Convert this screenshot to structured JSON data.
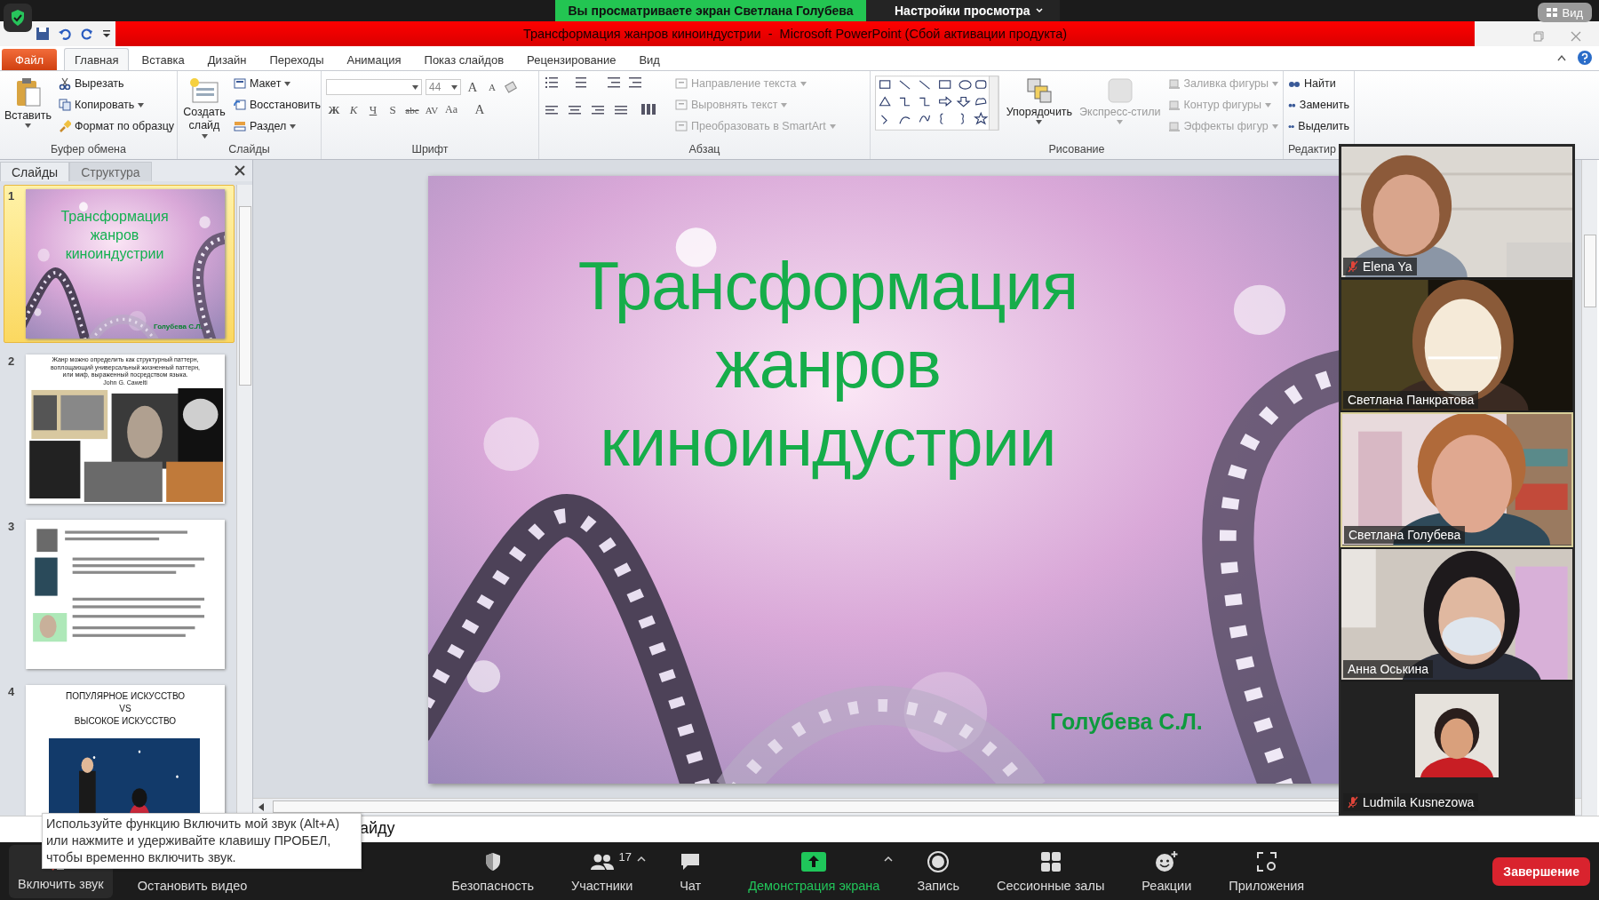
{
  "zoom_top": {
    "banner": "Вы просматриваете экран Светлана Голубева",
    "settings": "Настройки просмотра",
    "view": "Вид"
  },
  "window": {
    "title": "Трансформация жанров киноиндустрии  -  Microsoft PowerPoint (Сбой активации продукта)"
  },
  "tabs": [
    {
      "label": "Файл",
      "kind": "file",
      "selected": false
    },
    {
      "label": "Главная",
      "kind": "tab",
      "selected": true
    },
    {
      "label": "Вставка",
      "kind": "tab",
      "selected": false
    },
    {
      "label": "Дизайн",
      "kind": "tab",
      "selected": false
    },
    {
      "label": "Переходы",
      "kind": "tab",
      "selected": false
    },
    {
      "label": "Анимация",
      "kind": "tab",
      "selected": false
    },
    {
      "label": "Показ слайдов",
      "kind": "tab",
      "selected": false
    },
    {
      "label": "Рецензирование",
      "kind": "tab",
      "selected": false
    },
    {
      "label": "Вид",
      "kind": "tab",
      "selected": false
    }
  ],
  "ribbon": {
    "clipboard": {
      "label": "Буфер обмена",
      "paste": "Вставить",
      "cut": "Вырезать",
      "copy": "Копировать",
      "format_painter": "Формат по образцу"
    },
    "slides": {
      "label": "Слайды",
      "new_slide": "Создать слайд",
      "layout": "Макет",
      "reset": "Восстановить",
      "section": "Раздел"
    },
    "font": {
      "label": "Шрифт",
      "font_size": "44",
      "size_buttons": [
        "A",
        "A"
      ],
      "buttons": [
        "Ж",
        "К",
        "Ч",
        "S",
        "abc",
        "AV",
        "Aa",
        "A"
      ]
    },
    "paragraph": {
      "label": "Абзац",
      "items": [
        {
          "label": "Направление текста",
          "disabled": true
        },
        {
          "label": "Выровнять текст",
          "disabled": true
        },
        {
          "label": "Преобразовать в SmartArt",
          "disabled": true
        }
      ]
    },
    "drawing": {
      "label": "Рисование",
      "arrange": "Упорядочить",
      "quick_styles": {
        "label": "Экспресс-стили",
        "disabled": true
      },
      "items": [
        {
          "label": "Заливка фигуры",
          "disabled": true
        },
        {
          "label": "Контур фигуры",
          "disabled": true
        },
        {
          "label": "Эффекты фигур",
          "disabled": true
        }
      ]
    },
    "editing": {
      "label": "Редактир",
      "items": [
        "Найти",
        "Заменить",
        "Выделить"
      ]
    }
  },
  "slide_panel": {
    "tabs": [
      {
        "label": "Слайды",
        "selected": true
      },
      {
        "label": "Структура",
        "selected": false
      }
    ],
    "thumbnails": [
      {
        "number": "1",
        "kind": "title",
        "selected": true,
        "lines": [
          "Трансформация",
          "жанров",
          "киноиндустрии"
        ],
        "author": "Голубева С.Л."
      },
      {
        "number": "2",
        "kind": "collage",
        "selected": false,
        "lines": [
          "Жанр можно определить как структурный паттерн,",
          "воплощающий универсальный жизненный паттерн,",
          "или миф, выраженный посредством языка."
        ],
        "author": "John G. Cawelti"
      },
      {
        "number": "3",
        "kind": "text-page",
        "selected": false
      },
      {
        "number": "4",
        "kind": "heading",
        "selected": false,
        "lines": [
          "ПОПУЛЯРНОЕ ИСКУССТВО",
          "VS",
          "ВЫСОКОЕ ИСКУССТВО"
        ]
      }
    ]
  },
  "slide": {
    "title_lines": [
      "Трансформация",
      "жанров",
      "киноиндустрии"
    ],
    "author": "Голубева С.Л."
  },
  "notes": {
    "text": "айду"
  },
  "participants": [
    {
      "name": "Elena Ya",
      "kind": "video",
      "muted": true,
      "speaking": false
    },
    {
      "name": "Светлана Панкратова",
      "kind": "video",
      "muted": false,
      "speaking": false
    },
    {
      "name": "Светлана Голубева",
      "kind": "video",
      "muted": false,
      "speaking": true
    },
    {
      "name": "Анна Оськина",
      "kind": "video",
      "muted": false,
      "speaking": false
    },
    {
      "name": "Ludmila Kusnezowa",
      "muted": true,
      "speaking": false
    }
  ],
  "tooltip": {
    "text": "Используйте функцию Включить мой звук (Alt+A) или нажмите и удерживайте клавишу ПРОБЕЛ, чтобы временно включить звук."
  },
  "toolbar": {
    "audio": {
      "label": "Включить звук",
      "muted": true
    },
    "video": {
      "label": "Остановить видео"
    },
    "items": [
      {
        "label": "Безопасность",
        "kind": "security",
        "caret": false,
        "highlighted": false
      },
      {
        "label": "Участники",
        "kind": "participants",
        "count": "17",
        "caret": true,
        "highlighted": false
      },
      {
        "label": "Чат",
        "kind": "chat",
        "caret": false,
        "highlighted": false
      },
      {
        "label": "Демонстрация экрана",
        "kind": "share",
        "caret": true,
        "highlighted": true
      },
      {
        "label": "Запись",
        "kind": "record",
        "caret": false,
        "highlighted": false
      },
      {
        "label": "Сессионные залы",
        "kind": "rooms",
        "caret": false,
        "highlighted": false
      },
      {
        "label": "Реакции",
        "kind": "reactions",
        "caret": false,
        "highlighted": false
      },
      {
        "label": "Приложения",
        "kind": "apps",
        "caret": false,
        "highlighted": false
      }
    ],
    "end": "Завершение"
  }
}
